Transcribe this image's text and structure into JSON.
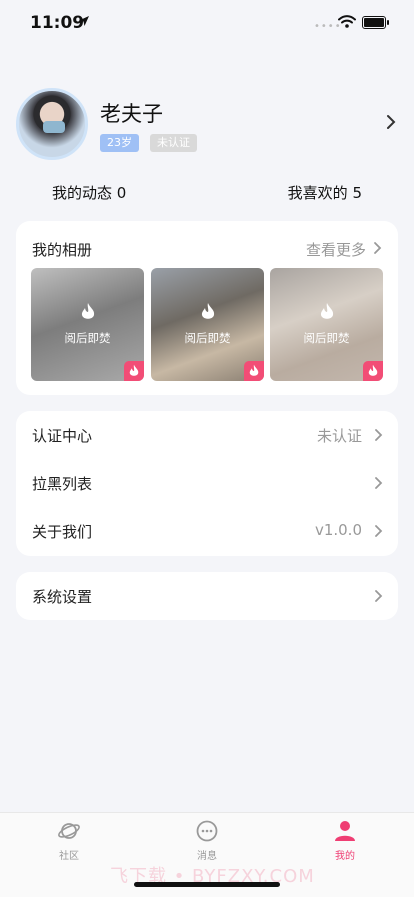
{
  "status_bar": {
    "time": "11:09"
  },
  "profile": {
    "name": "老夫子",
    "age_tag": "23岁",
    "auth_tag": "未认证"
  },
  "stats": {
    "dynamics_label": "我的动态",
    "dynamics_count": "0",
    "likes_label": "我喜欢的",
    "likes_count": "5"
  },
  "album": {
    "title": "我的相册",
    "more_label": "查看更多",
    "photos": [
      {
        "caption": "阅后即焚"
      },
      {
        "caption": "阅后即焚"
      },
      {
        "caption": "阅后即焚"
      }
    ]
  },
  "menu": {
    "items": [
      {
        "label": "认证中心",
        "value": "未认证"
      },
      {
        "label": "拉黑列表",
        "value": ""
      },
      {
        "label": "关于我们",
        "value": "v1.0.0"
      }
    ],
    "settings_label": "系统设置"
  },
  "tabbar": {
    "items": [
      {
        "label": "社区",
        "icon": "planet-icon"
      },
      {
        "label": "消息",
        "icon": "chat-bubble-icon"
      },
      {
        "label": "我的",
        "icon": "person-icon"
      }
    ],
    "active_index": 2
  },
  "watermark": "飞下载 • BYFZXY.COM",
  "colors": {
    "accent": "#ef3e73",
    "age_tag": "#9fc0f5",
    "auth_tag": "#d9d9d9",
    "background": "#f4f5f9"
  }
}
